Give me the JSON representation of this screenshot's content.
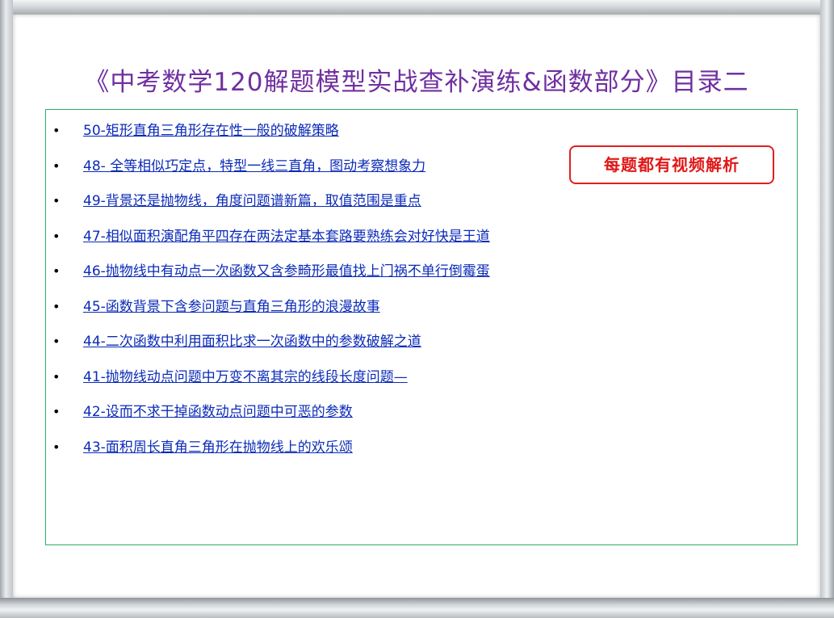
{
  "slide": {
    "title": "《中考数学120解题模型实战查补演练&函数部分》目录二",
    "badge": "每题都有视频解析",
    "bullet_glyph": "•",
    "colors": {
      "title": "#7030a0",
      "link": "#0b2bb8",
      "badge_border": "#e02020",
      "box_border": "#2eae5c"
    },
    "items": [
      {
        "label": "50-矩形直角三角形存在性一般的破解策略"
      },
      {
        "label": "48- 全等相似巧定点，特型一线三直角，图动考察想象力"
      },
      {
        "label": "49-背景还是抛物线，角度问题谱新篇，取值范围是重点"
      },
      {
        "label": "47-相似面积演配角平四存在两法定基本套路要熟练会对好快是王道"
      },
      {
        "label": "46-抛物线中有动点一次函数又含参畸形最值找上门祸不单行倒霉蛋"
      },
      {
        "label": "45-函数背景下含参问题与直角三角形的浪漫故事"
      },
      {
        "label": "44-二次函数中利用面积比求一次函数中的参数破解之道"
      },
      {
        "label": "41-抛物线动点问题中万变不离其宗的线段长度问题—"
      },
      {
        "label": "42-设而不求干掉函数动点问题中可恶的参数"
      },
      {
        "label": "43-面积周长直角三角形在抛物线上的欢乐颂"
      }
    ]
  }
}
